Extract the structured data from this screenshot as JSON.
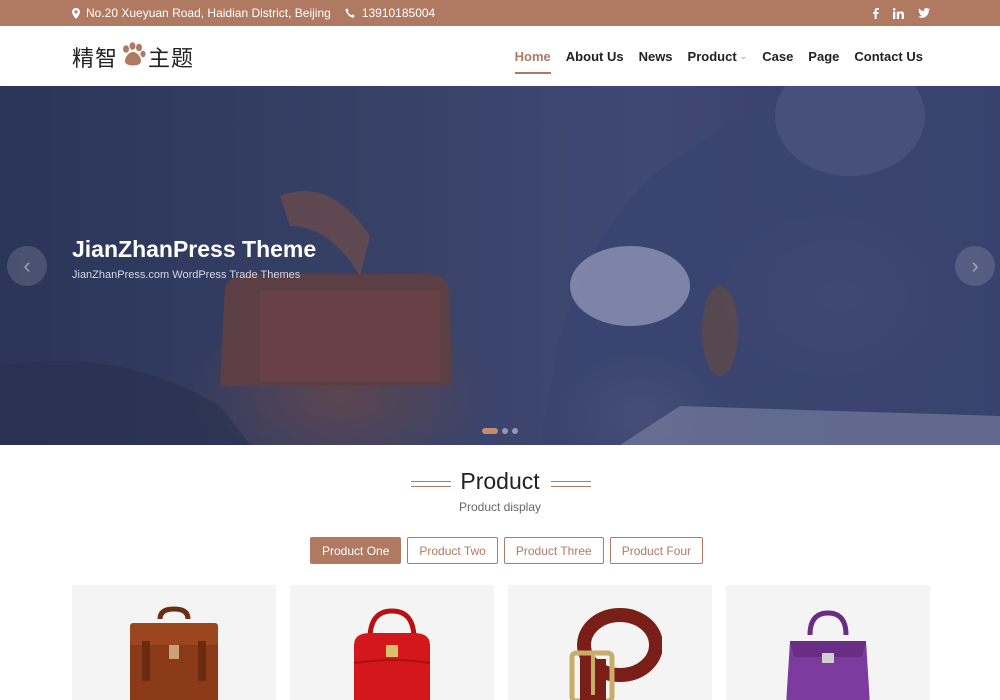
{
  "topbar": {
    "address": "No.20 Xueyuan Road, Haidian District, Beijing",
    "phone": "13910185004",
    "social": [
      "facebook-icon",
      "linkedin-icon",
      "twitter-icon"
    ]
  },
  "header": {
    "logo_text_1": "精智",
    "logo_text_2": "主题",
    "nav": [
      {
        "label": "Home",
        "active": true
      },
      {
        "label": "About Us"
      },
      {
        "label": "News"
      },
      {
        "label": "Product",
        "has_dropdown": true
      },
      {
        "label": "Case"
      },
      {
        "label": "Page"
      },
      {
        "label": "Contact Us"
      }
    ]
  },
  "hero": {
    "title": "JianZhanPress Theme",
    "subtitle": "JianZhanPress.com WordPress Trade Themes",
    "slides": 3,
    "active_slide": 1
  },
  "product": {
    "title": "Product",
    "subtitle": "Product display",
    "tabs": [
      "Product One",
      "Product Two",
      "Product Three",
      "Product Four"
    ],
    "active_tab": 0,
    "items": [
      "briefcase",
      "red-handbag",
      "leather-belt",
      "purple-handbag"
    ]
  },
  "colors": {
    "accent": "#b07a62",
    "hero_overlay": "#2f3a62"
  }
}
